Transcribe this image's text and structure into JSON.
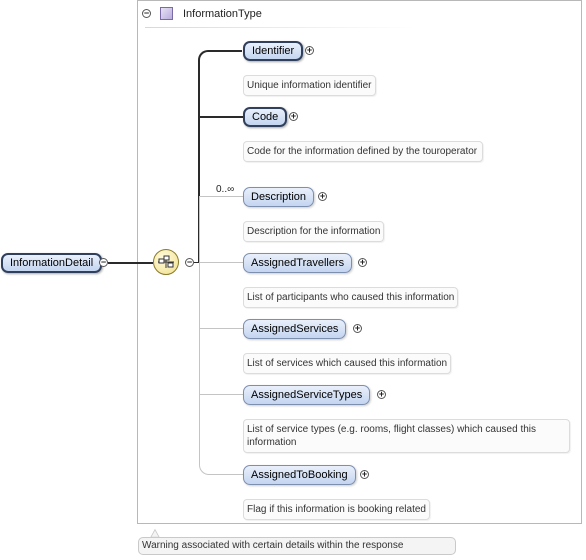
{
  "root": {
    "label": "InformationDetail"
  },
  "type": {
    "label": "InformationType"
  },
  "cardinality": "0..∞",
  "elements": [
    {
      "label": "Identifier",
      "doc": "Unique information identifier"
    },
    {
      "label": "Code",
      "doc": "Code for the information defined by the touroperator"
    },
    {
      "label": "Description",
      "doc": "Description for the information"
    },
    {
      "label": "AssignedTravellers",
      "doc": "List of participants who caused this information"
    },
    {
      "label": "AssignedServices",
      "doc": "List of services which caused this information"
    },
    {
      "label": "AssignedServiceTypes",
      "doc": "List of service types (e.g. rooms, flight classes) which caused this information"
    },
    {
      "label": "AssignedToBooking",
      "doc": "Flag if this information is booking related"
    }
  ],
  "warning": "Warning associated with certain details within the response",
  "icons": {
    "collapse": "minus-circle-icon",
    "expand": "plus-circle-icon",
    "type": "complex-type-icon",
    "compositor": "sequence-compositor-icon"
  }
}
